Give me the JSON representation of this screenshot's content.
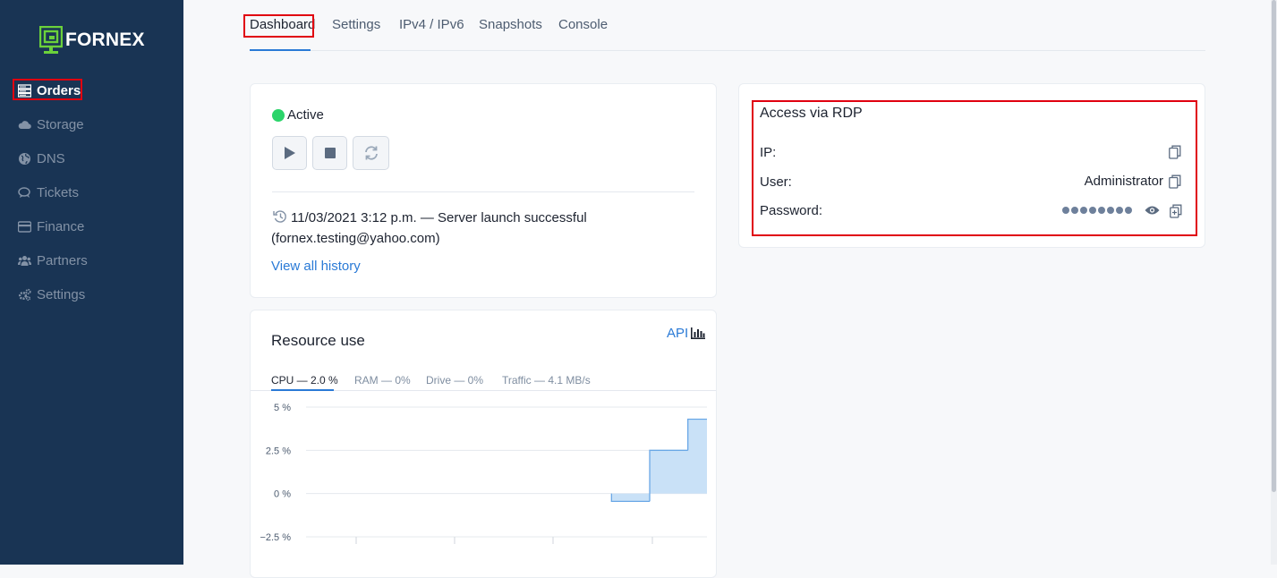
{
  "sidebar": {
    "logo_text": "FORNEX",
    "items": [
      {
        "label": "Orders",
        "icon": "server-icon",
        "active": true
      },
      {
        "label": "Storage",
        "icon": "cloud-icon",
        "active": false
      },
      {
        "label": "DNS",
        "icon": "globe-icon",
        "active": false
      },
      {
        "label": "Tickets",
        "icon": "chat-icon",
        "active": false
      },
      {
        "label": "Finance",
        "icon": "credit-card-icon",
        "active": false
      },
      {
        "label": "Partners",
        "icon": "users-icon",
        "active": false
      },
      {
        "label": "Settings",
        "icon": "gears-icon",
        "active": false
      }
    ]
  },
  "tabs": [
    "Dashboard",
    "Settings",
    "IPv4 / IPv6",
    "Snapshots",
    "Console"
  ],
  "status": {
    "text": "Active",
    "color": "#2bd46a",
    "history_text": "11/03/2021 3:12 p.m. — Server launch successful (fornex.testing@yahoo.com)",
    "history_link": "View all history"
  },
  "rdp": {
    "title": "Access via RDP",
    "ip_label": "IP:",
    "ip_value": "",
    "user_label": "User:",
    "user_value": "Administrator",
    "password_label": "Password:"
  },
  "resources": {
    "title": "Resource use",
    "api_label": "API",
    "tabs": [
      "CPU — 2.0 %",
      "RAM — 0%",
      "Drive — 0%",
      "Traffic — 4.1 MB/s"
    ]
  },
  "chart_data": {
    "type": "area",
    "title": "",
    "xlabel": "",
    "ylabel": "",
    "y_ticks": [
      "5 %",
      "2.5 %",
      "0 %",
      "−2.5 %"
    ],
    "ylim": [
      -2.5,
      5
    ],
    "step": true,
    "series": [
      {
        "values": [
          0,
          0,
          0,
          0,
          0,
          0,
          0,
          0,
          0,
          0,
          0,
          0,
          0,
          0,
          0,
          0,
          -0.45,
          -0.45,
          2.5,
          2.5,
          4.3
        ]
      }
    ],
    "fill_color": "#c9e1f7",
    "line_color": "#6aa8e6",
    "grid": true
  },
  "colors": {
    "sidebar": "#193454",
    "accent": "#2a7ad6",
    "highlight": "#e0000f"
  }
}
